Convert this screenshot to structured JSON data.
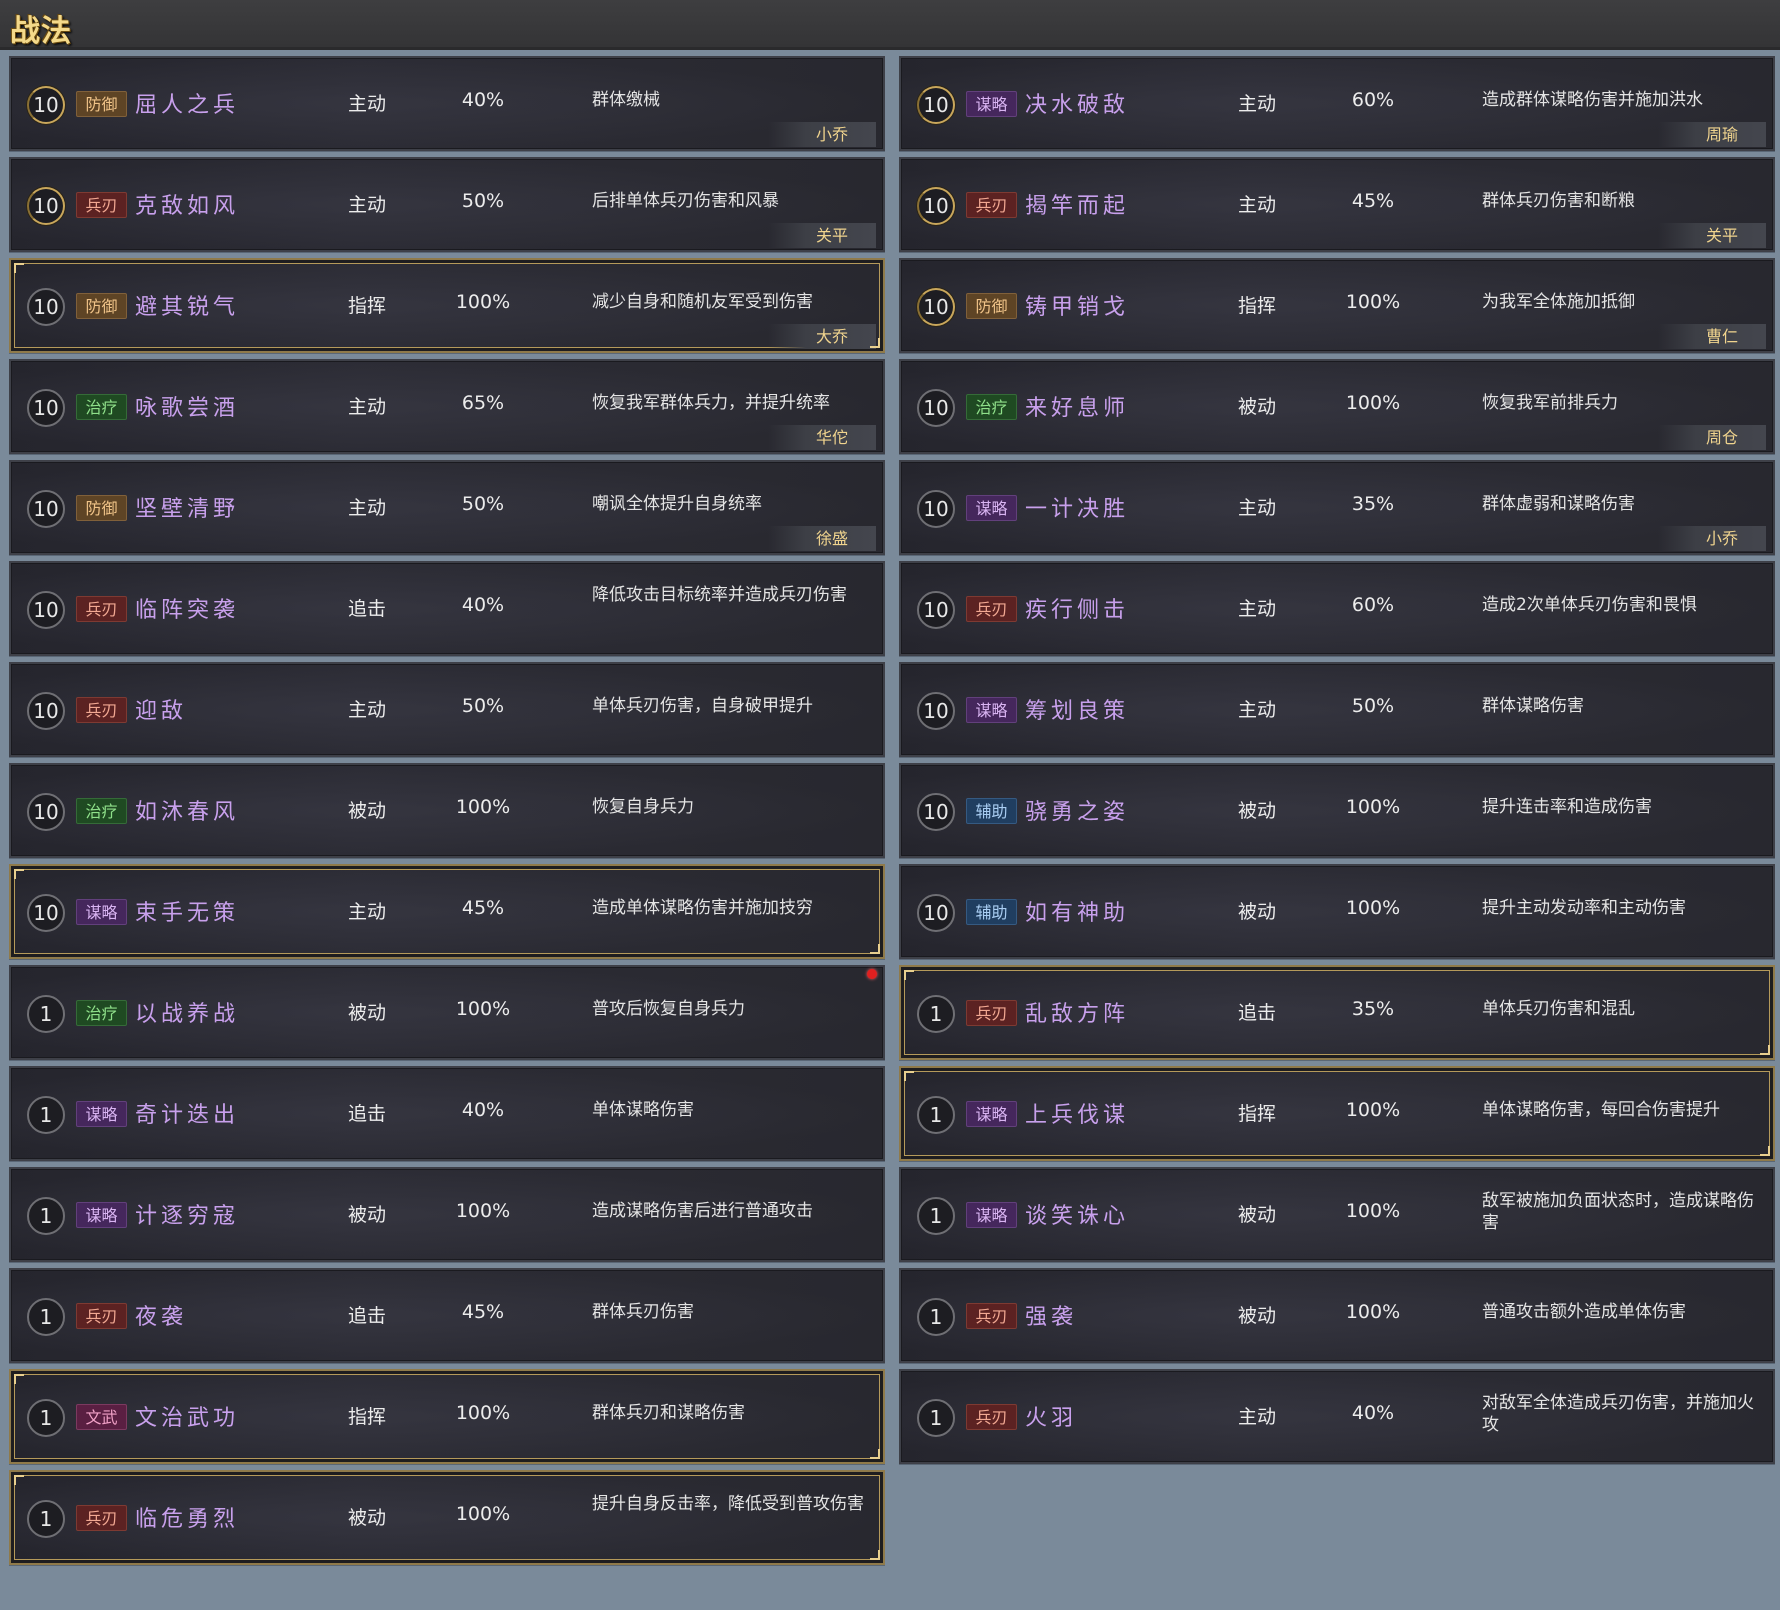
{
  "header": {
    "title": "战法"
  },
  "left_column": [
    {
      "level": "10",
      "level_style": "gold",
      "type": "防御",
      "type_class": "defense",
      "name": "屈人之兵",
      "kind": "主动",
      "rate": "40%",
      "desc": "群体缴械",
      "hero": "小乔",
      "frame": "normal"
    },
    {
      "level": "10",
      "level_style": "gold",
      "type": "兵刃",
      "type_class": "blade",
      "name": "克敌如风",
      "kind": "主动",
      "rate": "50%",
      "desc": "后排单体兵刃伤害和风暴",
      "hero": "关平",
      "frame": "normal"
    },
    {
      "level": "10",
      "level_style": "normal",
      "type": "防御",
      "type_class": "defense",
      "name": "避其锐气",
      "kind": "指挥",
      "rate": "100%",
      "desc": "减少自身和随机友军受到伤害",
      "hero": "大乔",
      "frame": "gold"
    },
    {
      "level": "10",
      "level_style": "normal",
      "type": "治疗",
      "type_class": "heal",
      "name": "咏歌尝酒",
      "kind": "主动",
      "rate": "65%",
      "desc": "恢复我军群体兵力，并提升统率",
      "hero": "华佗",
      "frame": "normal"
    },
    {
      "level": "10",
      "level_style": "normal",
      "type": "防御",
      "type_class": "defense",
      "name": "坚壁清野",
      "kind": "主动",
      "rate": "50%",
      "desc": "嘲讽全体提升自身统率",
      "hero": "徐盛",
      "frame": "normal"
    },
    {
      "level": "10",
      "level_style": "normal",
      "type": "兵刃",
      "type_class": "blade",
      "name": "临阵突袭",
      "kind": "追击",
      "rate": "40%",
      "desc": "降低攻击目标统率并造成兵刃伤害",
      "hero": "",
      "frame": "normal",
      "two_line": true
    },
    {
      "level": "10",
      "level_style": "normal",
      "type": "兵刃",
      "type_class": "blade",
      "name": "迎敌",
      "kind": "主动",
      "rate": "50%",
      "desc": "单体兵刃伤害，自身破甲提升",
      "hero": "",
      "frame": "normal"
    },
    {
      "level": "10",
      "level_style": "normal",
      "type": "治疗",
      "type_class": "heal",
      "name": "如沐春风",
      "kind": "被动",
      "rate": "100%",
      "desc": "恢复自身兵力",
      "hero": "",
      "frame": "normal"
    },
    {
      "level": "10",
      "level_style": "normal",
      "type": "谋略",
      "type_class": "strategy",
      "name": "束手无策",
      "kind": "主动",
      "rate": "45%",
      "desc": "造成单体谋略伤害并施加技穷",
      "hero": "",
      "frame": "gold"
    },
    {
      "level": "1",
      "level_style": "normal",
      "type": "治疗",
      "type_class": "heal",
      "name": "以战养战",
      "kind": "被动",
      "rate": "100%",
      "desc": "普攻后恢复自身兵力",
      "hero": "",
      "frame": "normal",
      "dot": true
    },
    {
      "level": "1",
      "level_style": "normal",
      "type": "谋略",
      "type_class": "strategy",
      "name": "奇计迭出",
      "kind": "追击",
      "rate": "40%",
      "desc": "单体谋略伤害",
      "hero": "",
      "frame": "normal"
    },
    {
      "level": "1",
      "level_style": "normal",
      "type": "谋略",
      "type_class": "strategy",
      "name": "计逐穷寇",
      "kind": "被动",
      "rate": "100%",
      "desc": "造成谋略伤害后进行普通攻击",
      "hero": "",
      "frame": "normal"
    },
    {
      "level": "1",
      "level_style": "normal",
      "type": "兵刃",
      "type_class": "blade",
      "name": "夜袭",
      "kind": "追击",
      "rate": "45%",
      "desc": "群体兵刃伤害",
      "hero": "",
      "frame": "normal"
    },
    {
      "level": "1",
      "level_style": "normal",
      "type": "文武",
      "type_class": "civil",
      "name": "文治武功",
      "kind": "指挥",
      "rate": "100%",
      "desc": "群体兵刃和谋略伤害",
      "hero": "",
      "frame": "gold"
    },
    {
      "level": "1",
      "level_style": "normal",
      "type": "兵刃",
      "type_class": "blade",
      "name": "临危勇烈",
      "kind": "被动",
      "rate": "100%",
      "desc": "提升自身反击率，降低受到普攻伤害",
      "hero": "",
      "frame": "gold",
      "two_line": true
    }
  ],
  "right_column": [
    {
      "level": "10",
      "level_style": "gold",
      "type": "谋略",
      "type_class": "strategy",
      "name": "决水破敌",
      "kind": "主动",
      "rate": "60%",
      "desc": "造成群体谋略伤害并施加洪水",
      "hero": "周瑜",
      "frame": "normal"
    },
    {
      "level": "10",
      "level_style": "gold",
      "type": "兵刃",
      "type_class": "blade",
      "name": "揭竿而起",
      "kind": "主动",
      "rate": "45%",
      "desc": "群体兵刃伤害和断粮",
      "hero": "关平",
      "frame": "normal"
    },
    {
      "level": "10",
      "level_style": "gold",
      "type": "防御",
      "type_class": "defense",
      "name": "铸甲销戈",
      "kind": "指挥",
      "rate": "100%",
      "desc": "为我军全体施加抵御",
      "hero": "曹仁",
      "frame": "normal"
    },
    {
      "level": "10",
      "level_style": "normal",
      "type": "治疗",
      "type_class": "heal",
      "name": "来好息师",
      "kind": "被动",
      "rate": "100%",
      "desc": "恢复我军前排兵力",
      "hero": "周仓",
      "frame": "normal"
    },
    {
      "level": "10",
      "level_style": "normal",
      "type": "谋略",
      "type_class": "strategy",
      "name": "一计决胜",
      "kind": "主动",
      "rate": "35%",
      "desc": "群体虚弱和谋略伤害",
      "hero": "小乔",
      "frame": "normal"
    },
    {
      "level": "10",
      "level_style": "normal",
      "type": "兵刃",
      "type_class": "blade",
      "name": "疾行侧击",
      "kind": "主动",
      "rate": "60%",
      "desc": "造成2次单体兵刃伤害和畏惧",
      "hero": "",
      "frame": "normal"
    },
    {
      "level": "10",
      "level_style": "normal",
      "type": "谋略",
      "type_class": "strategy",
      "name": "筹划良策",
      "kind": "主动",
      "rate": "50%",
      "desc": "群体谋略伤害",
      "hero": "",
      "frame": "normal"
    },
    {
      "level": "10",
      "level_style": "normal",
      "type": "辅助",
      "type_class": "support",
      "name": "骁勇之姿",
      "kind": "被动",
      "rate": "100%",
      "desc": "提升连击率和造成伤害",
      "hero": "",
      "frame": "normal"
    },
    {
      "level": "10",
      "level_style": "normal",
      "type": "辅助",
      "type_class": "support",
      "name": "如有神助",
      "kind": "被动",
      "rate": "100%",
      "desc": "提升主动发动率和主动伤害",
      "hero": "",
      "frame": "normal"
    },
    {
      "level": "1",
      "level_style": "normal",
      "type": "兵刃",
      "type_class": "blade",
      "name": "乱敌方阵",
      "kind": "追击",
      "rate": "35%",
      "desc": "单体兵刃伤害和混乱",
      "hero": "",
      "frame": "gold"
    },
    {
      "level": "1",
      "level_style": "normal",
      "type": "谋略",
      "type_class": "strategy",
      "name": "上兵伐谋",
      "kind": "指挥",
      "rate": "100%",
      "desc": "单体谋略伤害，每回合伤害提升",
      "hero": "",
      "frame": "gold"
    },
    {
      "level": "1",
      "level_style": "normal",
      "type": "谋略",
      "type_class": "strategy",
      "name": "谈笑诛心",
      "kind": "被动",
      "rate": "100%",
      "desc": "敌军被施加负面状态时，造成谋略伤害",
      "hero": "",
      "frame": "normal",
      "two_line": true
    },
    {
      "level": "1",
      "level_style": "normal",
      "type": "兵刃",
      "type_class": "blade",
      "name": "强袭",
      "kind": "被动",
      "rate": "100%",
      "desc": "普通攻击额外造成单体伤害",
      "hero": "",
      "frame": "normal"
    },
    {
      "level": "1",
      "level_style": "normal",
      "type": "兵刃",
      "type_class": "blade",
      "name": "火羽",
      "kind": "主动",
      "rate": "40%",
      "desc": "对敌军全体造成兵刃伤害，并施加火攻",
      "hero": "",
      "frame": "normal",
      "two_line": true
    }
  ]
}
